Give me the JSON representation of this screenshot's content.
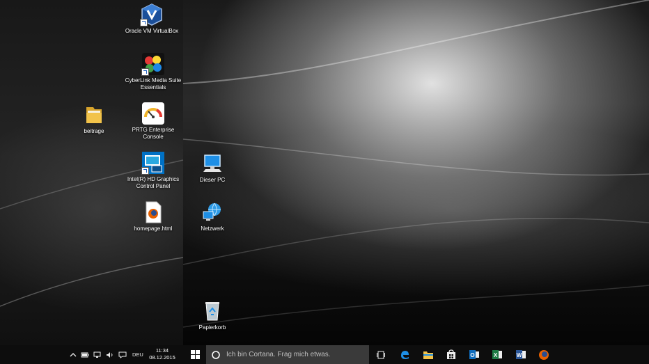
{
  "desktop": {
    "icons": [
      {
        "label": "Oracle VM VirtualBox",
        "icon": "virtualbox-icon"
      },
      {
        "label": "CyberLink Media Suite Essentials",
        "icon": "cyberlink-icon"
      },
      {
        "label": "beitrage",
        "icon": "folder-icon"
      },
      {
        "label": "PRTG Enterprise Console",
        "icon": "prtg-icon"
      },
      {
        "label": "Intel(R) HD Graphics Control Panel",
        "icon": "intel-graphics-icon"
      },
      {
        "label": "Dieser PC",
        "icon": "computer-icon"
      },
      {
        "label": "homepage.html",
        "icon": "firefox-html-icon"
      },
      {
        "label": "Netzwerk",
        "icon": "network-icon"
      },
      {
        "label": "Papierkorb",
        "icon": "recycle-bin-icon"
      }
    ]
  },
  "taskbar": {
    "language": "DEU",
    "time": "11:34",
    "date": "08.12.2015",
    "search_placeholder": "Ich bin Cortana. Frag mich etwas.",
    "pinned": [
      "task-view-icon",
      "edge-icon",
      "file-explorer-icon",
      "store-icon",
      "outlook-icon",
      "excel-icon",
      "word-icon",
      "firefox-icon"
    ],
    "tray_icons": [
      "chevron-up-icon",
      "battery-icon",
      "network-icon",
      "volume-icon",
      "notifications-icon"
    ]
  },
  "colors": {
    "taskbar_bg": "#0d0d0d",
    "search_bg": "#3a3a3a",
    "windows_blue": "#1e8fe6",
    "excel_green": "#1d7a44",
    "word_blue": "#2b579a",
    "outlook_blue": "#0f6cbd",
    "folder_yellow": "#f2c34a"
  }
}
